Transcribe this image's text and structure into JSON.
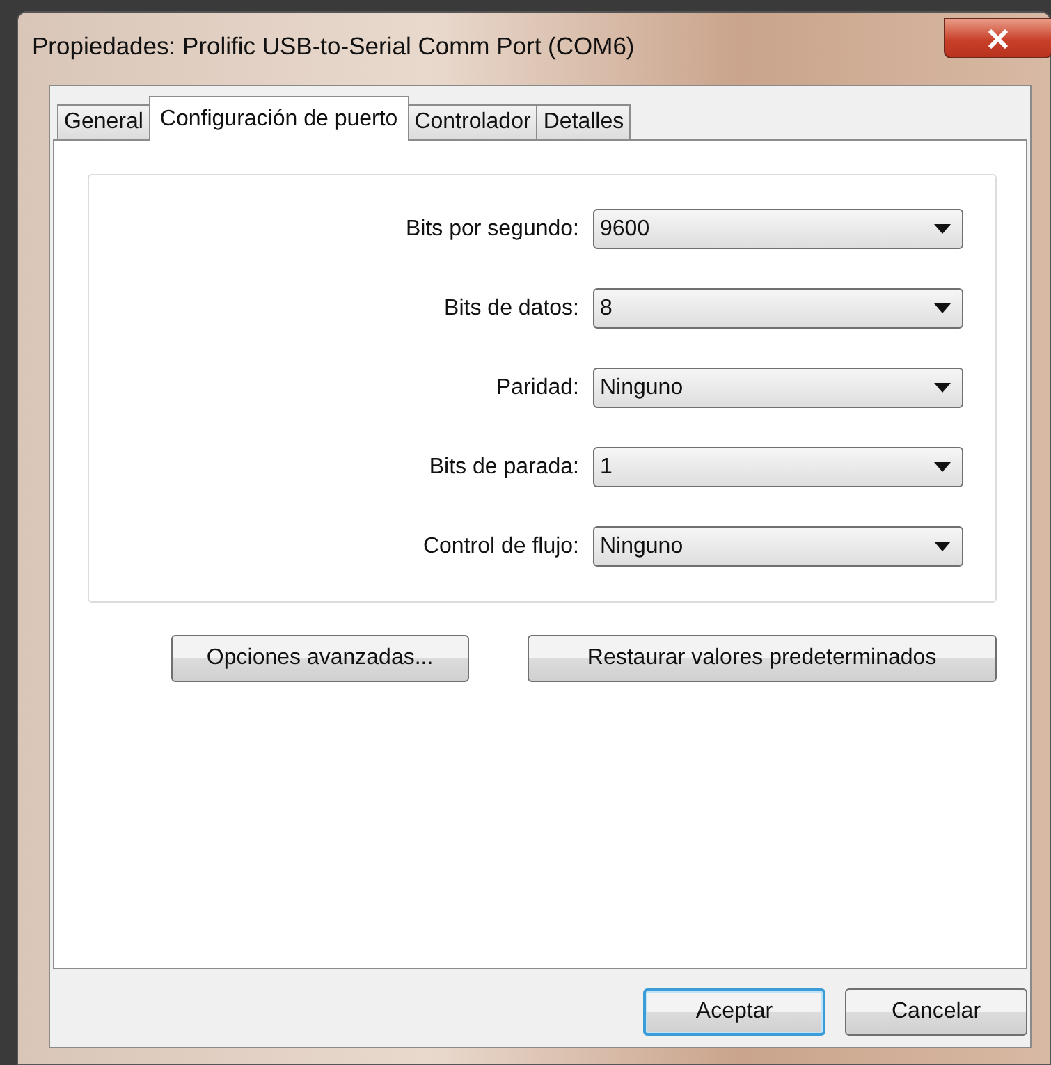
{
  "window": {
    "title": "Propiedades: Prolific USB-to-Serial Comm Port (COM6)"
  },
  "tabs": [
    {
      "label": "General",
      "selected": false
    },
    {
      "label": "Configuración de puerto",
      "selected": true
    },
    {
      "label": "Controlador",
      "selected": false
    },
    {
      "label": "Detalles",
      "selected": false
    }
  ],
  "settings": [
    {
      "label": "Bits por segundo:",
      "value": "9600"
    },
    {
      "label": "Bits de datos:",
      "value": "8"
    },
    {
      "label": "Paridad:",
      "value": "Ninguno"
    },
    {
      "label": "Bits de parada:",
      "value": "1"
    },
    {
      "label": "Control de flujo:",
      "value": "Ninguno"
    }
  ],
  "panel_buttons": [
    "Opciones avanzadas...",
    "Restaurar valores predeterminados"
  ],
  "dialog_buttons": [
    {
      "label": "Aceptar",
      "focused": true
    },
    {
      "label": "Cancelar",
      "focused": false
    }
  ]
}
